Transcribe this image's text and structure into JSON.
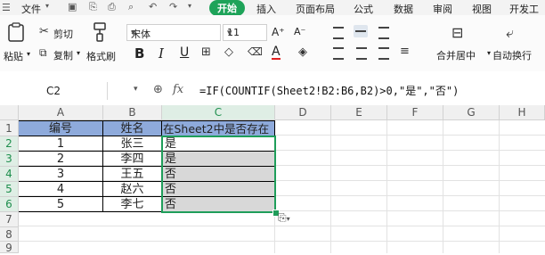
{
  "menubar": {
    "file": "文件",
    "tabs": [
      "开始",
      "插入",
      "页面布局",
      "公式",
      "数据",
      "审阅",
      "视图",
      "开发工"
    ],
    "active_tab": "开始"
  },
  "ribbon": {
    "paste": "粘贴",
    "cut": "剪切",
    "copy": "复制",
    "format_painter": "格式刷",
    "font_name": "宋体",
    "font_size": "11",
    "bold": "B",
    "italic": "I",
    "underline": "U",
    "font_color_letter": "A",
    "increase_font": "A⁺",
    "decrease_font": "A⁻",
    "merge_center": "合并居中",
    "wrap_text": "自动换行",
    "accent_color": "#1ea359"
  },
  "formula_bar": {
    "cell_ref": "C2",
    "fx": "fx",
    "formula": "=IF(COUNTIF(Sheet2!B2:B6,B2)>0,\"是\",\"否\")"
  },
  "sheet": {
    "columns": [
      "A",
      "B",
      "C",
      "D",
      "E",
      "F",
      "G",
      "H"
    ],
    "rows": [
      "1",
      "2",
      "3",
      "4",
      "5",
      "6",
      "7",
      "8",
      "9"
    ],
    "header": [
      "编号",
      "姓名",
      "在Sheet2中是否存在"
    ],
    "data": [
      [
        "1",
        "张三",
        "是"
      ],
      [
        "2",
        "李四",
        "是"
      ],
      [
        "3",
        "王五",
        "否"
      ],
      [
        "4",
        "赵六",
        "否"
      ],
      [
        "5",
        "李七",
        "否"
      ]
    ],
    "header_fill": "#8eaadb",
    "selection_color": "#1f9e5a"
  },
  "paste_options_icon": "paste-options-icon"
}
